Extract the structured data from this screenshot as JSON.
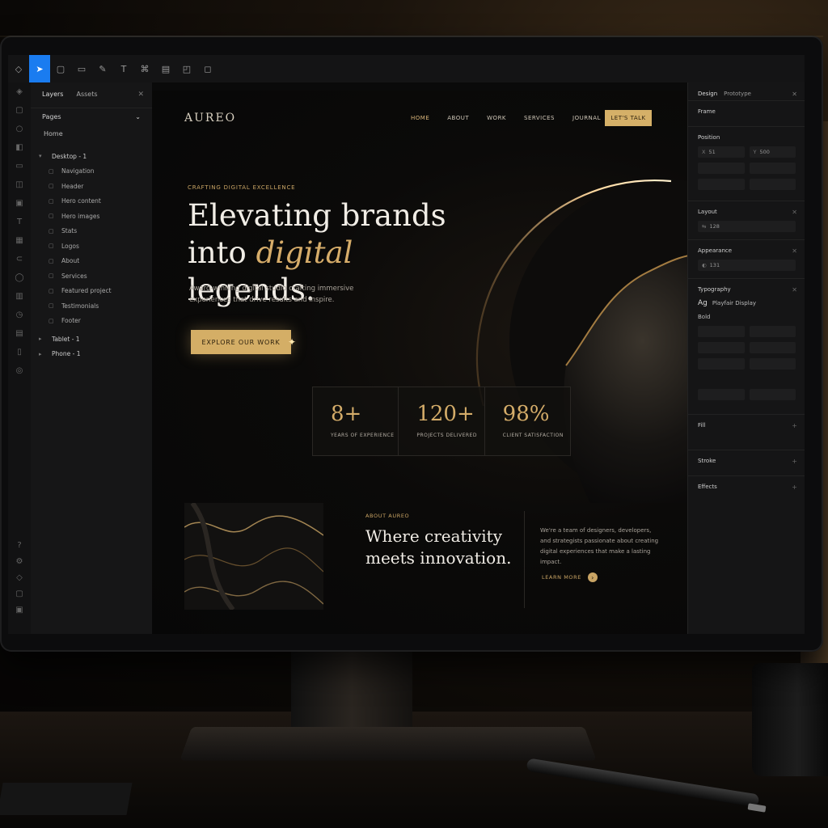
{
  "layers_panel": {
    "tab_layers": "Layers",
    "tab_assets": "Assets",
    "pages_label": "Pages",
    "page_home": "Home",
    "frames": [
      {
        "label": "Desktop - 1"
      },
      {
        "label": "Navigation"
      },
      {
        "label": "Header"
      },
      {
        "label": "Hero content"
      },
      {
        "label": "Hero images"
      },
      {
        "label": "Stats"
      },
      {
        "label": "Logos"
      },
      {
        "label": "About"
      },
      {
        "label": "Services"
      },
      {
        "label": "Featured project"
      },
      {
        "label": "Testimonials"
      },
      {
        "label": "Footer"
      },
      {
        "label": "Tablet - 1"
      },
      {
        "label": "Phone - 1"
      }
    ]
  },
  "site": {
    "logo": "AUREO",
    "nav": [
      "HOME",
      "ABOUT",
      "WORK",
      "SERVICES",
      "JOURNAL"
    ],
    "cta": "LET'S TALK",
    "eyebrow": "CRAFTING DIGITAL EXCELLENCE",
    "headline_line1": "Elevating brands",
    "headline_into": "into",
    "headline_italic": "digital",
    "headline_end": "legends.",
    "subtext": "Award-winning digital studio crafting immersive experiences that drive results and inspire.",
    "explore_button": "EXPLORE OUR WORK",
    "stats": [
      {
        "number": "8+",
        "label": "YEARS OF EXPERIENCE"
      },
      {
        "number": "120+",
        "label": "PROJECTS DELIVERED"
      },
      {
        "number": "98%",
        "label": "CLIENT SATISFACTION"
      }
    ],
    "about_eyebrow": "ABOUT AUREO",
    "about_title": "Where creativity meets innovation.",
    "about_text": "We're a team of designers, developers, and strategists passionate about creating digital experiences that make a lasting impact.",
    "learn_more": "LEARN MORE"
  },
  "design_panel": {
    "tab_design": "Design",
    "tab_prototype": "Prototype",
    "frame_label": "Frame",
    "position_label": "Position",
    "layout_label": "Layout",
    "appearance_label": "Appearance",
    "typography_label": "Typography",
    "font_family": "Playfair Display",
    "font_weight": "Bold",
    "fill_label": "Fill",
    "stroke_label": "Stroke",
    "effects_label": "Effects",
    "pos_x": "51",
    "pos_y": "500",
    "layout_w": "128",
    "appearance_val": "131"
  },
  "colors": {
    "accent_gold": "#d4ae66",
    "toolbar_active": "#1a7cf0",
    "background": "#0a0a0a"
  }
}
